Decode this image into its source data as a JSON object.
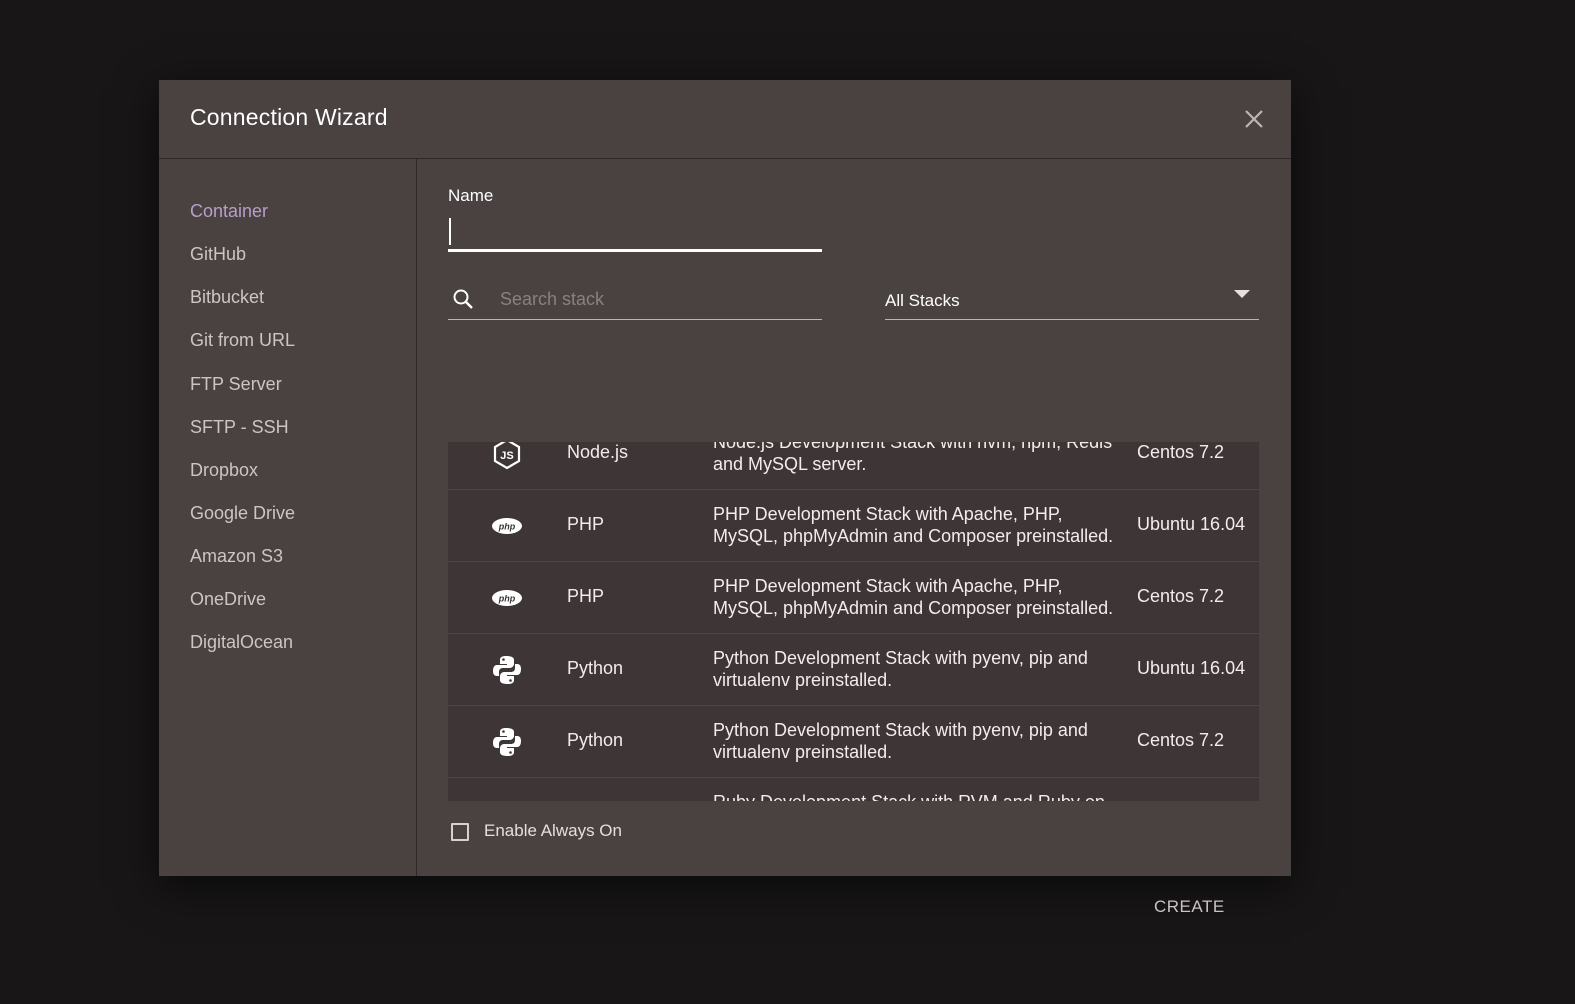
{
  "dialog": {
    "title": "Connection Wizard",
    "close_icon": "close-icon"
  },
  "sidebar": {
    "items": [
      {
        "label": "Container",
        "active": true
      },
      {
        "label": "GitHub"
      },
      {
        "label": "Bitbucket"
      },
      {
        "label": "Git from URL"
      },
      {
        "label": "FTP Server"
      },
      {
        "label": "SFTP - SSH"
      },
      {
        "label": "Dropbox"
      },
      {
        "label": "Google Drive"
      },
      {
        "label": "Amazon S3"
      },
      {
        "label": "OneDrive"
      },
      {
        "label": "DigitalOcean"
      }
    ]
  },
  "form": {
    "name_label": "Name",
    "name_value": "",
    "search_placeholder": "Search stack",
    "stack_filter": "All Stacks"
  },
  "stacks": [
    {
      "icon": "nodejs-icon",
      "name": "Node.js",
      "description": "Node.js Development Stack with nvm, npm, Redis and MySQL server.",
      "os": "Centos 7.2"
    },
    {
      "icon": "php-icon",
      "name": "PHP",
      "description": "PHP Development Stack with Apache, PHP, MySQL, phpMyAdmin and Composer preinstalled.",
      "os": "Ubuntu 16.04"
    },
    {
      "icon": "php-icon",
      "name": "PHP",
      "description": "PHP Development Stack with Apache, PHP, MySQL, phpMyAdmin and Composer preinstalled.",
      "os": "Centos 7.2"
    },
    {
      "icon": "python-icon",
      "name": "Python",
      "description": "Python Development Stack with pyenv, pip and virtualenv preinstalled.",
      "os": "Ubuntu 16.04"
    },
    {
      "icon": "python-icon",
      "name": "Python",
      "description": "Python Development Stack with pyenv, pip and virtualenv preinstalled.",
      "os": "Centos 7.2"
    },
    {
      "icon": "ruby-icon",
      "name": "",
      "description": "Ruby Development Stack with RVM and Ruby on",
      "os": ""
    }
  ],
  "options": {
    "always_on_label": "Enable Always On",
    "always_on_checked": false
  },
  "actions": {
    "create_label": "CREATE"
  }
}
